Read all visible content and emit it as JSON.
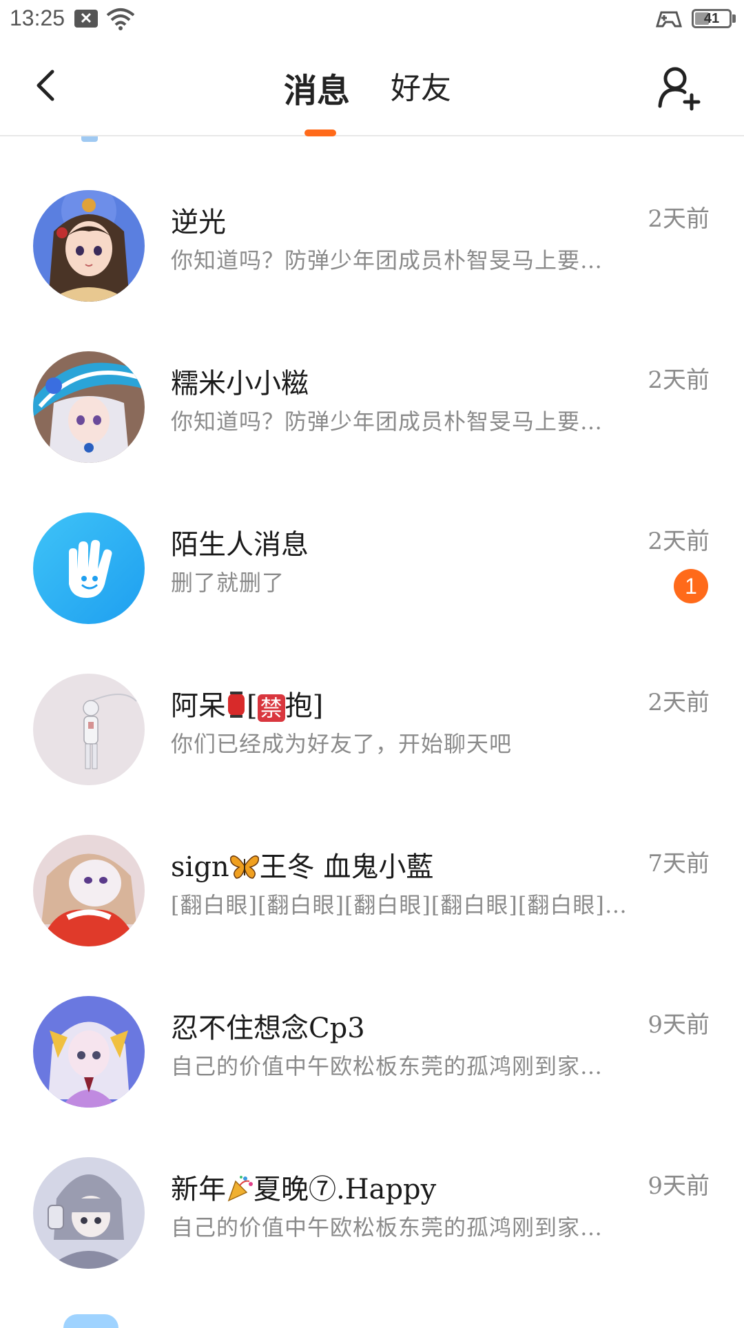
{
  "status_bar": {
    "time": "13:25",
    "battery": "41",
    "battery_level": 0.41
  },
  "header": {
    "tabs": [
      {
        "label": "消息",
        "active": true
      },
      {
        "label": "好友",
        "active": false
      }
    ],
    "accent_color": "#ff6a1a"
  },
  "conversations": [
    {
      "name": "逆光",
      "time": "2天前",
      "preview": "你知道吗？防弹少年团成员朴智旻马上要…",
      "avatar": "anime-girl-avatar-blue"
    },
    {
      "name": "糯米小小糍",
      "time": "2天前",
      "preview": "你知道吗？防弹少年团成员朴智旻马上要…",
      "avatar": "anime-girl-avatar-hat"
    },
    {
      "name": "陌生人消息",
      "time": "2天前",
      "preview": "删了就删了",
      "badge": "1",
      "avatar": "hand-icon-avatar"
    },
    {
      "name_parts": [
        "阿呆",
        "[",
        "禁",
        "抱]"
      ],
      "name": "阿呆🏮[禁抱]",
      "time": "2天前",
      "preview": "你们已经成为好友了，开始聊天吧",
      "avatar": "anime-figure-avatar-white"
    },
    {
      "name_parts": [
        "sign",
        "王冬 血鬼小藍"
      ],
      "name": "sign🦋王冬 血鬼小藍",
      "time": "7天前",
      "preview": "[翻白眼][翻白眼][翻白眼][翻白眼][翻白眼]…",
      "avatar": "anime-girl-avatar-red"
    },
    {
      "name": "忍不住想念Cp3",
      "time": "9天前",
      "preview": "自己的价值中午欧松板东莞的孤鸿刚到家…",
      "avatar": "anime-girl-avatar-purple"
    },
    {
      "name_parts": [
        "新年",
        "夏晚⑦.Happy"
      ],
      "name": "新年🎉夏晚⑦.Happy",
      "time": "9天前",
      "preview": "自己的价值中午欧松板东莞的孤鸿刚到家…",
      "avatar": "anime-hood-avatar-grey"
    }
  ]
}
